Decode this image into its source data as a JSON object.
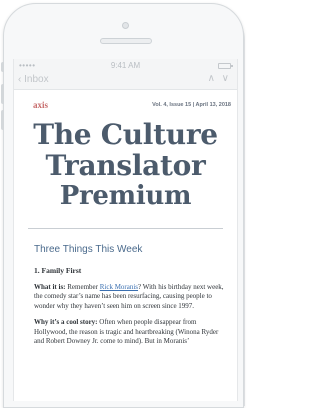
{
  "statusbar": {
    "carrier": "•••••",
    "time": "9:41 AM"
  },
  "navbar": {
    "back_label": "‹ Inbox",
    "arrows": "∧ ∨"
  },
  "email": {
    "logo": "axis",
    "issue_line": "Vol. 4, Issue 15 | April 13, 2018",
    "title_line1": "The Culture",
    "title_line2": "Translator",
    "title_line3": "Premium",
    "section_heading": "Three Things This Week",
    "item1_heading": "1. Family First",
    "p1_label": "What it is:",
    "p1_pre": " Remember ",
    "p1_link": "Rick Moranis",
    "p1_post": "? With his birthday next week, the comedy star’s name has been resurfacing, causing people to wonder why they haven’t seen him on screen since 1997.",
    "p2_label": "Why it’s a cool story:",
    "p2_text": " Often when people disappear from Hollywood, the reason is tragic and heartbreaking (Winona Ryder and Robert Downey Jr. come to mind). But in Moranis’"
  }
}
